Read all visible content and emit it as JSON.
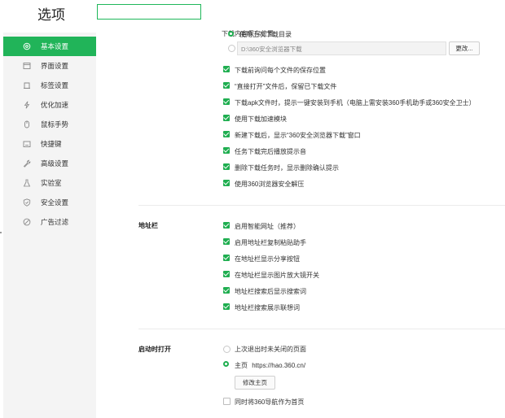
{
  "app": {
    "title": "选项",
    "search_value": ""
  },
  "sidebar": {
    "items": [
      {
        "label": "基本设置",
        "icon": "gear-icon",
        "active": true
      },
      {
        "label": "界面设置",
        "icon": "window-icon"
      },
      {
        "label": "标签设置",
        "icon": "tab-icon"
      },
      {
        "label": "优化加速",
        "icon": "lightning-icon"
      },
      {
        "label": "鼠标手势",
        "icon": "mouse-icon"
      },
      {
        "label": "快捷键",
        "icon": "keyboard-icon"
      },
      {
        "label": "高级设置",
        "icon": "wrench-icon"
      },
      {
        "label": "实验室",
        "icon": "flask-icon"
      },
      {
        "label": "安全设置",
        "icon": "shield-icon"
      },
      {
        "label": "广告过滤",
        "icon": "block-icon"
      }
    ]
  },
  "download": {
    "location_label": "下载内容保存位置:",
    "option_last_dir": "使用上次下载目录",
    "path_value": "D:\\360安全浏览器下载",
    "change_button": "更改...",
    "checkboxes": [
      "下载前询问每个文件的保存位置",
      "“直接打开”文件后，保留已下载文件",
      "下载apk文件时，提示一键安装到手机（电脑上需安装360手机助手或360安全卫士）",
      "使用下载加速模块",
      "新建下载后，显示“360安全浏览器下载”窗口",
      "任务下载完后播放提示音",
      "删除下载任务时，显示删除确认提示",
      "使用360浏览器安全解压"
    ]
  },
  "addressbar": {
    "title": "地址栏",
    "checkboxes": [
      "启用智能网址（推荐）",
      "启用地址栏复制粘贴助手",
      "在地址栏显示分享按钮",
      "在地址栏显示图片放大镜开关",
      "地址栏搜索后显示搜索词",
      "地址栏搜索展示联想词"
    ]
  },
  "startup": {
    "title": "启动时打开",
    "option_last_session": "上次退出时未关闭的页面",
    "option_homepage_label": "主页",
    "homepage_url": "https://hao.360.cn/",
    "modify_button": "修改主页",
    "nav_checkbox": "同时将360导航作为首页"
  },
  "colors": {
    "accent": "#21b459",
    "sidebar_bg": "#f4f4f4"
  }
}
